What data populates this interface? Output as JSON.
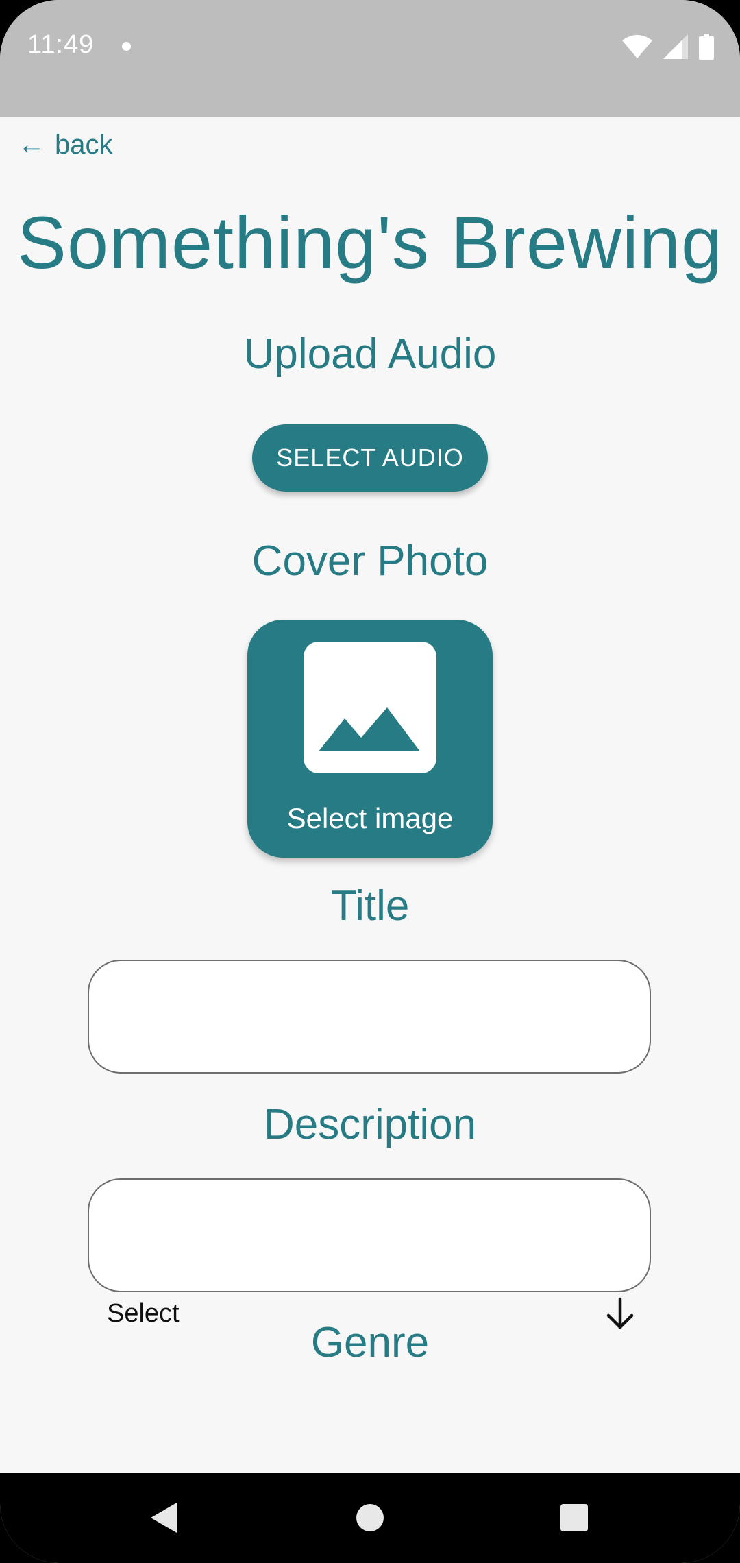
{
  "status_bar": {
    "time": "11:49",
    "icons": [
      "wifi-icon",
      "signal-icon",
      "battery-icon"
    ]
  },
  "nav": {
    "back_label": "back",
    "back_arrow": "←"
  },
  "app": {
    "title": "Something's Brewing"
  },
  "upload_audio": {
    "heading": "Upload Audio",
    "button_label": "SELECT AUDIO"
  },
  "cover_photo": {
    "heading": "Cover Photo",
    "picker_label": "Select image",
    "icon": "image-icon"
  },
  "title_field": {
    "heading": "Title",
    "value": ""
  },
  "description_field": {
    "heading": "Description",
    "value": ""
  },
  "genre": {
    "heading": "Genre",
    "selected": "Select",
    "icon": "arrow-down-icon"
  },
  "system_nav": {
    "buttons": [
      "back-triangle-icon",
      "home-circle-icon",
      "recents-square-icon"
    ]
  },
  "colors": {
    "accent": "#267b84",
    "background": "#f7f7f7",
    "status_bar": "#bdbdbd",
    "nav_bar": "#000000"
  }
}
